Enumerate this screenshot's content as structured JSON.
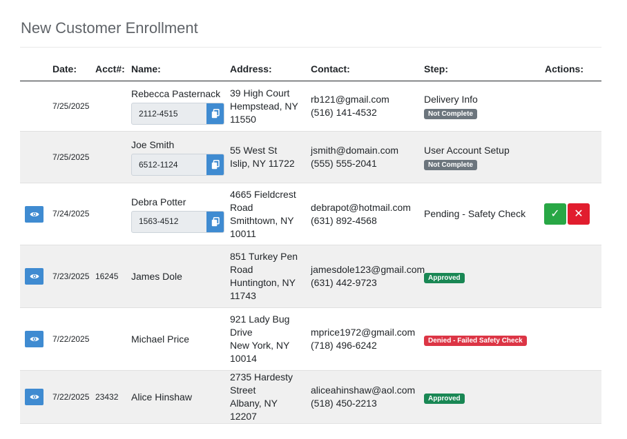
{
  "page": {
    "title": "New Customer Enrollment"
  },
  "columns": {
    "date": "Date:",
    "acct": "Acct#:",
    "name": "Name:",
    "address": "Address:",
    "contact": "Contact:",
    "step": "Step:",
    "actions": "Actions:"
  },
  "rows": [
    {
      "date": "7/25/2025",
      "acct": "",
      "name": "Rebecca Pasternack",
      "acct_field": "2112-4515",
      "address": [
        "39 High Court",
        "Hempstead, NY",
        "11550"
      ],
      "email": "rb121@gmail.com",
      "phone": "(516) 141-4532",
      "step": "Delivery Info",
      "badge": "Not Complete"
    },
    {
      "date": "7/25/2025",
      "acct": "",
      "name": "Joe Smith",
      "acct_field": "6512-1124",
      "address": [
        "55 West St",
        "Islip, NY 11722"
      ],
      "email": "jsmith@domain.com",
      "phone": "(555) 555-2041",
      "step": "User Account Setup",
      "badge": "Not Complete"
    },
    {
      "date": "7/24/2025",
      "acct": "",
      "name": "Debra Potter",
      "acct_field": "1563-4512",
      "address": [
        "4665 Fieldcrest",
        "Road",
        "Smithtown, NY",
        "10011"
      ],
      "email": "debrapot@hotmail.com",
      "phone": "(631) 892-4568",
      "step": "Pending - Safety Check",
      "approve": "✓",
      "deny": "✕"
    },
    {
      "date": "7/23/2025",
      "acct": "16245",
      "name": "James Dole",
      "address": [
        "851 Turkey Pen",
        "Road",
        "Huntington, NY",
        "11743"
      ],
      "email": "jamesdole123@gmail.com",
      "phone": "(631) 442-9723",
      "badge": "Approved"
    },
    {
      "date": "7/22/2025",
      "acct": "",
      "name": "Michael Price",
      "address": [
        "921 Lady Bug",
        "Drive",
        "New York, NY",
        "10014"
      ],
      "email": "mprice1972@gmail.com",
      "phone": "(718) 496-6242",
      "badge": "Denied - Failed Safety Check"
    },
    {
      "date": "7/22/2025",
      "acct": "23432",
      "name": "Alice Hinshaw",
      "address": [
        "2735 Hardesty",
        "Street",
        "Albany, NY 12207"
      ],
      "email": "aliceahinshaw@aol.com",
      "phone": "(518) 450-2213",
      "badge": "Approved"
    }
  ],
  "icons": {
    "view": "eye-icon",
    "copy": "copy-icon",
    "approve": "check-icon",
    "deny": "x-icon"
  },
  "colors": {
    "primary": "#3f8bd1",
    "success": "#28a745",
    "danger": "#e11d2e",
    "badge_gray": "#6c757d",
    "badge_green": "#198754",
    "badge_red": "#dc3545"
  }
}
